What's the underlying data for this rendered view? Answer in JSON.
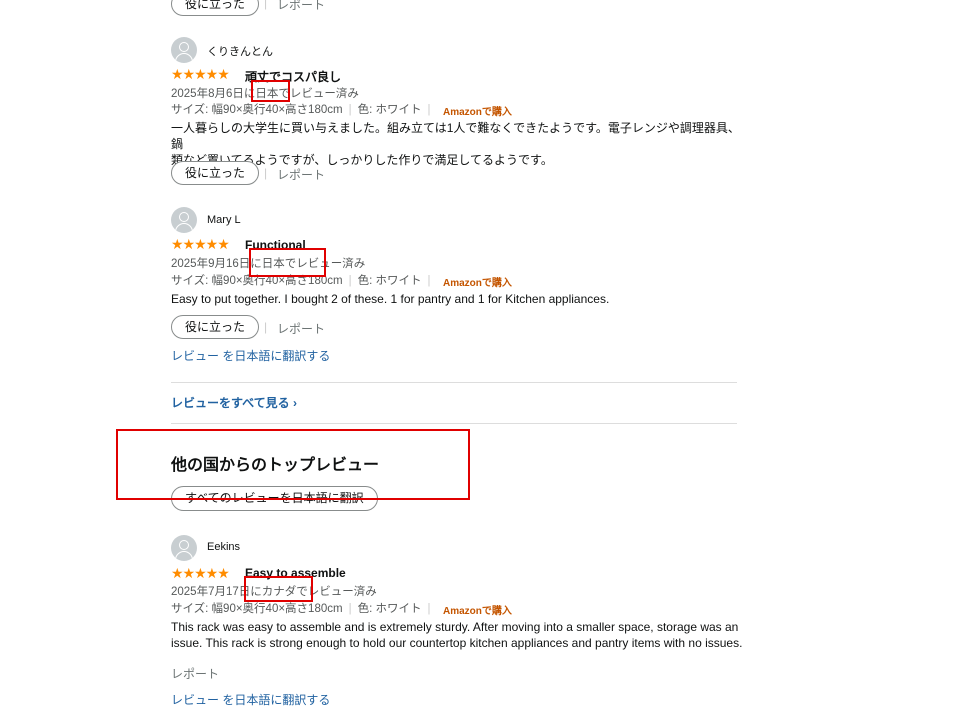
{
  "common": {
    "helpful": "役に立った",
    "report": "レポート",
    "verified_purchase": "Amazonで購入",
    "translate": "レビュー を日本語に翻訳する"
  },
  "reviews": [
    {
      "author": "くりきんとん",
      "stars": "★★★★★",
      "title": "頑丈でコスパ良し",
      "date": "2025年8月6日に日本でレビュー済み",
      "size": "サイズ: 幅90×奥行40×高さ180cm",
      "color": "色: ホワイト",
      "body_line1": "一人暮らしの大学生に買い与えました。組み立ては1人で難なくできたようです。電子レンジや調理器具、鍋",
      "body_line2": "類など置いてるようですが、しっかりした作りで満足してるようです。"
    },
    {
      "author": "Mary L",
      "stars": "★★★★★",
      "title": "Functional",
      "date": "2025年9月16日に日本でレビュー済み",
      "size": "サイズ: 幅90×奥行40×高さ180cm",
      "color": "色: ホワイト",
      "body_line1": "Easy to put together. I bought 2 of these. 1 for pantry and 1 for Kitchen appliances."
    },
    {
      "author": "Eekins",
      "stars": "★★★★★",
      "title": "Easy to assemble",
      "date": "2025年7月17日にカナダでレビュー済み",
      "size": "サイズ: 幅90×奥行40×高さ180cm",
      "color": "色: ホワイト",
      "body_line1": "This rack was easy to assemble and is extremely sturdy. After moving into a smaller space, storage was an",
      "body_line2": "issue. This rack is strong enough to hold our countertop kitchen appliances and pantry items with no issues."
    }
  ],
  "see_all": "レビューをすべて見る ›",
  "other_countries": {
    "heading": "他の国からのトップレビュー",
    "translate_all": "すべてのレビューを日本語に翻訳"
  }
}
